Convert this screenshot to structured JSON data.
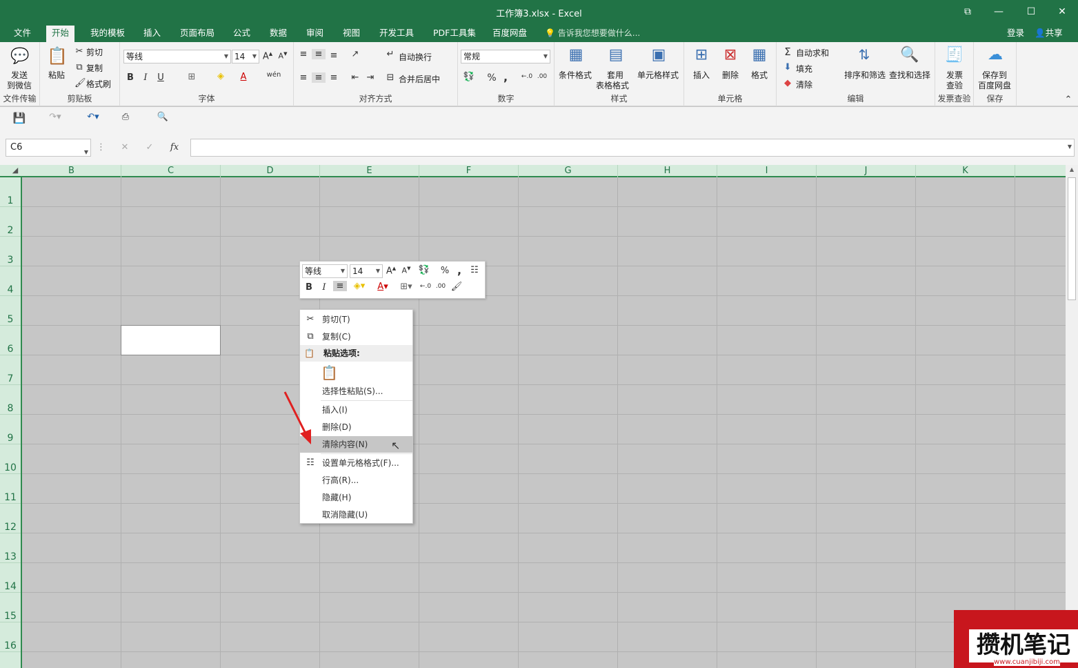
{
  "window": {
    "title": "工作簿3.xlsx - Excel",
    "restore_glyph": "⧉",
    "min_glyph": "—",
    "max_glyph": "☐",
    "close_glyph": "✕"
  },
  "tabs": [
    "文件",
    "开始",
    "我的模板",
    "插入",
    "页面布局",
    "公式",
    "数据",
    "审阅",
    "视图",
    "开发工具",
    "PDF工具集",
    "百度网盘"
  ],
  "tellme": "告诉我您想要做什么...",
  "account": {
    "login": "登录",
    "share": "共享"
  },
  "ribbon": {
    "send": {
      "label1": "发送",
      "label2": "到微信",
      "group": "文件传输"
    },
    "clipboard": {
      "paste": "粘贴",
      "cut": "剪切",
      "copy": "复制",
      "format_painter": "格式刷",
      "group": "剪贴板"
    },
    "font": {
      "name": "等线",
      "size": "14",
      "bold": "B",
      "italic": "I",
      "underline": "U",
      "group": "字体"
    },
    "align": {
      "wrap": "自动换行",
      "merge": "合并后居中",
      "group": "对齐方式"
    },
    "number": {
      "format": "常规",
      "percent": "%",
      "comma": ",",
      "group": "数字"
    },
    "styles": {
      "cond": "条件格式",
      "table1": "套用",
      "table2": "表格格式",
      "cell": "单元格样式",
      "group": "样式"
    },
    "cells": {
      "insert": "插入",
      "delete": "删除",
      "format": "格式",
      "group": "单元格"
    },
    "editing": {
      "autosum": "自动求和",
      "fill": "填充",
      "clear": "清除",
      "sort": "排序和筛选",
      "find": "查找和选择",
      "group": "编辑"
    },
    "check": {
      "l1": "发票",
      "l2": "查验",
      "group": "发票查验"
    },
    "save": {
      "l1": "保存到",
      "l2": "百度网盘",
      "group": "保存"
    }
  },
  "formula": {
    "namebox": "C6",
    "cancel": "✕",
    "enter": "✓",
    "fx": "fx"
  },
  "columns": [
    "B",
    "C",
    "D",
    "E",
    "F",
    "G",
    "H",
    "I",
    "J",
    "K"
  ],
  "rows": [
    "1",
    "2",
    "3",
    "4",
    "5",
    "6",
    "7",
    "8",
    "9",
    "10",
    "11",
    "12",
    "13",
    "14",
    "15",
    "16"
  ],
  "minibar": {
    "font": "等线",
    "size": "14",
    "bold": "B",
    "italic": "I",
    "percent": "%",
    "comma": ","
  },
  "context_menu": {
    "cut": "剪切(T)",
    "copy": "复制(C)",
    "paste_options": "粘贴选项:",
    "paste_special": "选择性粘贴(S)...",
    "insert": "插入(I)",
    "delete": "删除(D)",
    "clear": "清除内容(N)",
    "format_cells": "设置单元格格式(F)...",
    "row_height": "行高(R)...",
    "hide": "隐藏(H)",
    "unhide": "取消隐藏(U)"
  },
  "watermark": {
    "main": "攒机笔记",
    "sub": "www.cuanjibiji.com"
  },
  "colors": {
    "brand": "#217346",
    "arrow": "#e02020"
  }
}
